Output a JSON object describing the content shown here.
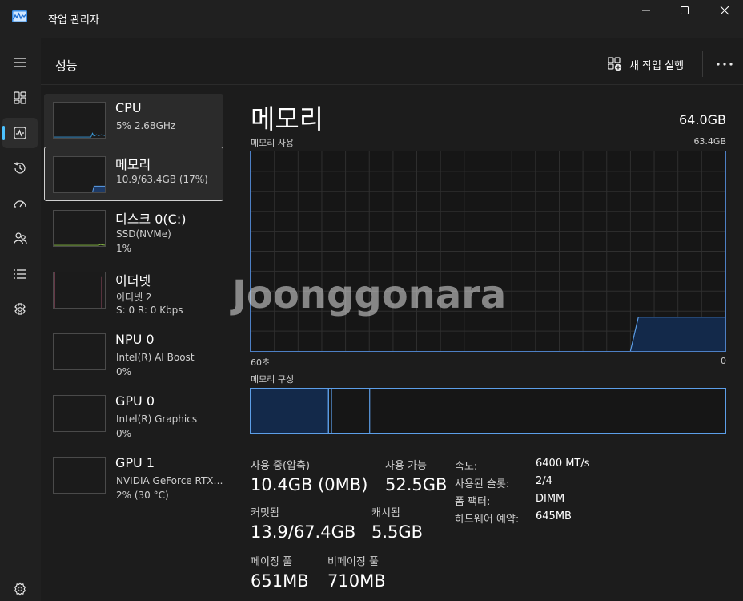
{
  "window": {
    "title": "작업 관리자"
  },
  "header": {
    "title": "성능",
    "new_task_label": "새 작업 실행"
  },
  "nav": {
    "items": [
      {
        "name": "hamburger-icon"
      },
      {
        "name": "processes-icon"
      },
      {
        "name": "performance-icon",
        "active": true
      },
      {
        "name": "app-history-icon"
      },
      {
        "name": "startup-apps-icon"
      },
      {
        "name": "users-icon"
      },
      {
        "name": "details-icon"
      },
      {
        "name": "services-icon"
      },
      {
        "name": "settings-icon"
      }
    ]
  },
  "resources": [
    {
      "name": "CPU",
      "sub1": "5%  2.68GHz",
      "sub2": ""
    },
    {
      "name": "메모리",
      "sub1": "10.9/63.4GB (17%)",
      "sub2": ""
    },
    {
      "name": "디스크 0(C:)",
      "sub1": "SSD(NVMe)",
      "sub2": "1%"
    },
    {
      "name": "이더넷",
      "sub1": "이더넷 2",
      "sub2": "S: 0  R: 0 Kbps"
    },
    {
      "name": "NPU 0",
      "sub1": "Intel(R) AI Boost",
      "sub2": "0%"
    },
    {
      "name": "GPU 0",
      "sub1": "Intel(R) Graphics",
      "sub2": "0%"
    },
    {
      "name": "GPU 1",
      "sub1": "NVIDIA GeForce RTX…",
      "sub2": "2% (30 °C)"
    }
  ],
  "detail": {
    "title": "메모리",
    "total": "64.0GB",
    "usage_label": "메모리 사용",
    "usage_max": "63.4GB",
    "time_left": "60초",
    "time_right": "0",
    "composition_label": "메모리 구성",
    "usage_series": [
      0,
      0,
      0,
      0,
      0,
      0,
      0,
      0,
      0,
      0,
      0,
      0,
      0,
      0,
      0,
      0,
      0,
      0,
      0,
      0,
      0,
      0,
      0,
      0,
      0,
      0,
      0,
      0,
      0,
      0,
      0,
      0,
      0,
      0,
      0,
      0,
      0,
      0,
      0,
      0,
      0,
      0,
      0,
      0,
      0,
      0,
      0,
      0,
      0,
      17,
      17,
      17,
      17,
      17,
      17,
      17,
      17,
      17,
      17,
      17,
      17
    ],
    "composition": {
      "in_use": 10.4,
      "modified": 0.2,
      "standby": 5.3,
      "total": 63.4
    }
  },
  "stats": {
    "in_use_label": "사용 중(압축)",
    "in_use_value": "10.4GB (0MB)",
    "available_label": "사용 가능",
    "available_value": "52.5GB",
    "committed_label": "커밋됨",
    "committed_value": "13.9/67.4GB",
    "cached_label": "캐시됨",
    "cached_value": "5.5GB",
    "paged_label": "페이징 풀",
    "paged_value": "651MB",
    "nonpaged_label": "비페이징 풀",
    "nonpaged_value": "710MB"
  },
  "specs": [
    {
      "label": "속도:",
      "value": "6400 MT/s"
    },
    {
      "label": "사용된 슬롯:",
      "value": "2/4"
    },
    {
      "label": "폼 팩터:",
      "value": "DIMM"
    },
    {
      "label": "하드웨어 예약:",
      "value": "645MB"
    }
  ],
  "watermark": "Joonggonara"
}
